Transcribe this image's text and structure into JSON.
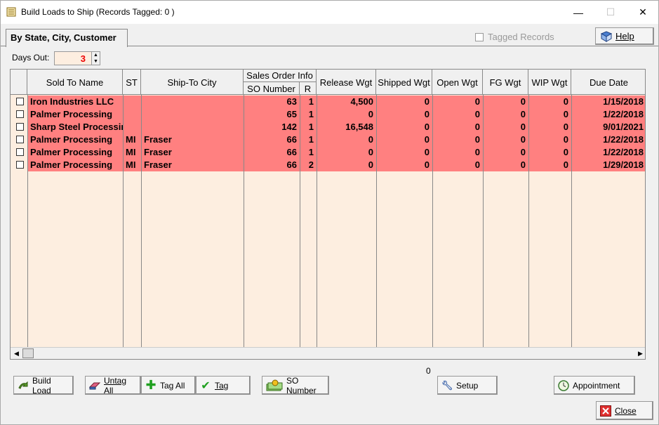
{
  "window": {
    "title": "Build Loads to Ship  (Records Tagged:  0 )",
    "min_glyph": "—",
    "max_glyph": "☐",
    "close_glyph": "✕"
  },
  "tabs": [
    {
      "label": "By State, City, Customer",
      "active": true
    }
  ],
  "tagged_records_label": "Tagged Records",
  "help_label": "Help",
  "days_out": {
    "label": "Days Out:",
    "value": "3"
  },
  "grid": {
    "columns": {
      "sold_to": "Sold To Name",
      "st": "ST",
      "city": "Ship-To City",
      "so_group": "Sales Order Info",
      "so_number": "SO Number",
      "r": "R",
      "release": "Release Wgt",
      "shipped": "Shipped Wgt",
      "open": "Open Wgt",
      "fg": "FG Wgt",
      "wip": "WIP Wgt",
      "due": "Due Date"
    },
    "rows": [
      {
        "sold_to": "Iron Industries LLC",
        "st": "",
        "city": "",
        "so": "63",
        "r": "1",
        "release": "4,500",
        "shipped": "0",
        "open": "0",
        "fg": "0",
        "wip": "0",
        "due": "1/15/2018"
      },
      {
        "sold_to": "Palmer Processing",
        "st": "",
        "city": "",
        "so": "65",
        "r": "1",
        "release": "0",
        "shipped": "0",
        "open": "0",
        "fg": "0",
        "wip": "0",
        "due": "1/22/2018"
      },
      {
        "sold_to": "Sharp Steel Processing",
        "st": "",
        "city": "",
        "so": "142",
        "r": "1",
        "release": "16,548",
        "shipped": "0",
        "open": "0",
        "fg": "0",
        "wip": "0",
        "due": "9/01/2021"
      },
      {
        "sold_to": "Palmer Processing",
        "st": "MI",
        "city": "Fraser",
        "so": "66",
        "r": "1",
        "release": "0",
        "shipped": "0",
        "open": "0",
        "fg": "0",
        "wip": "0",
        "due": "1/22/2018"
      },
      {
        "sold_to": "Palmer Processing",
        "st": "MI",
        "city": "Fraser",
        "so": "66",
        "r": "1",
        "release": "0",
        "shipped": "0",
        "open": "0",
        "fg": "0",
        "wip": "0",
        "due": "1/22/2018"
      },
      {
        "sold_to": "Palmer Processing",
        "st": "MI",
        "city": "Fraser",
        "so": "66",
        "r": "2",
        "release": "0",
        "shipped": "0",
        "open": "0",
        "fg": "0",
        "wip": "0",
        "due": "1/29/2018"
      }
    ]
  },
  "count_value": "0",
  "buttons": {
    "build_load_1": "Build",
    "build_load_2": "Load",
    "untag_all_1": "Untag",
    "untag_all_2": "All",
    "tag_all": "Tag All",
    "tag": "Tag",
    "so_number_1": "SO",
    "so_number_2": "Number",
    "setup": "Setup",
    "appointment": "Appointment",
    "close": "Close"
  },
  "colors": {
    "highlight_row": "#ff8080",
    "grid_bg": "#fdeee0",
    "days_value": "#e00000"
  }
}
